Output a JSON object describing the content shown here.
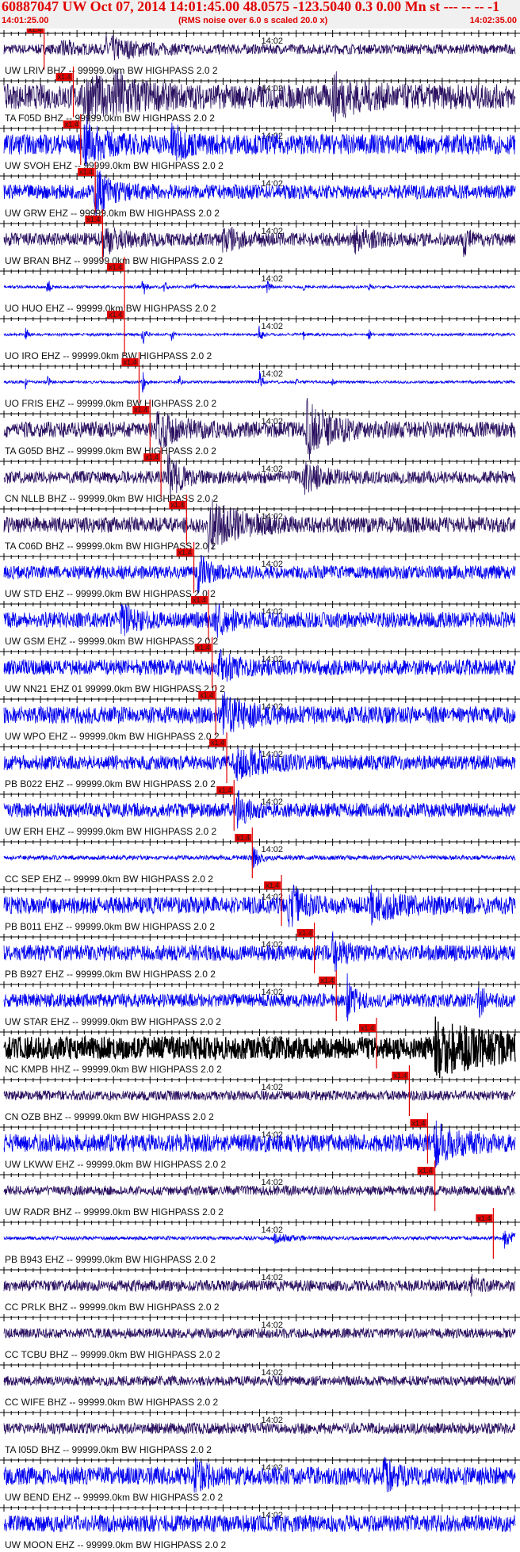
{
  "header": {
    "title": "60887047 UW Oct 07, 2014 14:01:45.00   48.0575 -123.5040  0.3 0.00 Mn st --- -- --   -1",
    "start_time": "14:01:25.00",
    "note": "(RMS noise over 6.0 s scaled 20.0 x)",
    "end_time": "14:02:35.00",
    "title_color": "#e00000"
  },
  "chart_data": {
    "type": "line",
    "title": "60887047 UW Oct 07, 2014 14:01:45.00   48.0575 -123.5040  0.3 0.00 Mn st --- -- --   -1",
    "x_range": [
      "14:01:25.00",
      "14:02:35.00"
    ],
    "x_range_seconds": [
      0,
      70
    ],
    "x_tick_label": "14:02",
    "x_tick_label_seconds": 35,
    "tick_interval_seconds": 1,
    "major_tick_interval_seconds": 5,
    "pick_label": "x1.4",
    "pick_color": "#e00000",
    "colors": {
      "eh": "#0000ee",
      "bh": "#2a1060",
      "hh": "#000000"
    },
    "traces": [
      {
        "label": "UW LRIV BHZ --  99999.0km BW  HIGHPASS  2.0  2",
        "kind": "bh",
        "pick_s": 5.5,
        "amp": 0.22,
        "bursts": [
          [
            14,
            2.2,
            4
          ],
          [
            8,
            1.6,
            1.5
          ]
        ]
      },
      {
        "label": "TA F05D BHZ --  99999.0km BW  HIGHPASS  2.0  2",
        "kind": "bh",
        "pick_s": 9.5,
        "amp": 0.55,
        "bursts": [
          [
            11,
            1.5,
            3
          ],
          [
            15,
            1.2,
            3
          ],
          [
            45,
            1.3,
            3
          ]
        ]
      },
      {
        "label": "UW SVOH EHZ --  99999.0km BW  HIGHPASS  2.0  2",
        "kind": "eh",
        "pick_s": 10.5,
        "amp": 0.45,
        "bursts": [
          [
            11,
            2.0,
            2
          ],
          [
            23,
            1.6,
            1.5
          ]
        ]
      },
      {
        "label": "UW GRW EHZ --  99999.0km BW  HIGHPASS  2.0  2",
        "kind": "eh",
        "pick_s": 12.5,
        "amp": 0.32,
        "bursts": [
          [
            12.5,
            3.0,
            2
          ]
        ]
      },
      {
        "label": "UW BRAN BHZ --  99999.0km BW  HIGHPASS  2.0  2",
        "kind": "bh",
        "pick_s": 13.5,
        "amp": 0.3,
        "bursts": [
          [
            13.5,
            2.0,
            2
          ],
          [
            30,
            1.7,
            2
          ],
          [
            48,
            1.4,
            2
          ],
          [
            63,
            2.2,
            0.6
          ]
        ]
      },
      {
        "label": "UO HUO EHZ --  99999.0km BW  HIGHPASS  2.0  2",
        "kind": "eh",
        "pick_s": 16.5,
        "amp": 0.06,
        "spiky": true,
        "bursts": [
          [
            6,
            8,
            0.25
          ],
          [
            19,
            10,
            0.3
          ],
          [
            22,
            5,
            0.2
          ],
          [
            26,
            4,
            0.2
          ],
          [
            36,
            6,
            0.3
          ],
          [
            41,
            4,
            0.2
          ],
          [
            50,
            3,
            0.2
          ]
        ]
      },
      {
        "label": "UO IRO EHZ --  99999.0km BW  HIGHPASS  2.0  2",
        "kind": "eh",
        "pick_s": 16.5,
        "amp": 0.06,
        "spiky": true,
        "bursts": [
          [
            3,
            5,
            0.2
          ],
          [
            19,
            8,
            0.3
          ],
          [
            23,
            5,
            0.2
          ],
          [
            35,
            8,
            0.3
          ],
          [
            41,
            3,
            0.2
          ],
          [
            50,
            4,
            0.2
          ]
        ]
      },
      {
        "label": "UO FRIS EHZ --  99999.0km BW  HIGHPASS  2.0  2",
        "kind": "eh",
        "pick_s": 18.5,
        "amp": 0.06,
        "spiky": true,
        "bursts": [
          [
            3,
            5,
            0.2
          ],
          [
            6,
            6,
            0.2
          ],
          [
            19,
            8,
            0.3
          ],
          [
            24,
            5,
            0.2
          ],
          [
            35,
            8,
            0.3
          ],
          [
            40,
            3,
            0.2
          ],
          [
            45,
            2,
            0.2
          ]
        ]
      },
      {
        "label": "TA G05D BHZ --  99999.0km BW  HIGHPASS  2.0  2",
        "kind": "bh",
        "pick_s": 20.0,
        "amp": 0.35,
        "bursts": [
          [
            21,
            1.8,
            3
          ],
          [
            41.5,
            3.2,
            3
          ]
        ]
      },
      {
        "label": "CN NLLB BHZ --  99999.0km BW  HIGHPASS  2.0  2",
        "kind": "bh",
        "pick_s": 21.5,
        "amp": 0.28,
        "bursts": [
          [
            22.5,
            3.5,
            1.5
          ],
          [
            41,
            2.0,
            2.5
          ]
        ]
      },
      {
        "label": "TA C06D BHZ --  99999.0km BW  HIGHPASS  2.0  2",
        "kind": "bh",
        "pick_s": 25.0,
        "amp": 0.35,
        "bursts": [
          [
            28,
            2.6,
            4
          ]
        ]
      },
      {
        "label": "UW STD EHZ --  99999.0km BW  HIGHPASS  2.0  2",
        "kind": "eh",
        "pick_s": 26.0,
        "amp": 0.3,
        "bursts": [
          [
            26.5,
            3.0,
            1.2
          ]
        ]
      },
      {
        "label": "UW GSM EHZ --  99999.0km BW  HIGHPASS  2.0  2",
        "kind": "eh",
        "pick_s": 28.0,
        "amp": 0.35,
        "bursts": [
          [
            16,
            1.5,
            2
          ],
          [
            29,
            1.6,
            2
          ]
        ]
      },
      {
        "label": "UW NN21 EHZ 01  99999.0km BW  HIGHPASS  2.0  2",
        "kind": "eh",
        "pick_s": 28.5,
        "amp": 0.35,
        "bursts": [
          [
            29.5,
            1.5,
            2
          ]
        ]
      },
      {
        "label": "UW WPO EHZ --  99999.0km BW  HIGHPASS  2.0  2",
        "kind": "eh",
        "pick_s": 29.0,
        "amp": 0.38,
        "bursts": [
          [
            30,
            2.0,
            3
          ]
        ]
      },
      {
        "label": "PB B022 EHZ --  99999.0km BW  HIGHPASS  2.0  2",
        "kind": "eh",
        "pick_s": 30.5,
        "amp": 0.32,
        "bursts": [
          [
            31.5,
            1.8,
            4
          ]
        ]
      },
      {
        "label": "UW ERH EHZ --  99999.0km BW  HIGHPASS  2.0  2",
        "kind": "eh",
        "pick_s": 31.5,
        "amp": 0.32,
        "bursts": [
          [
            32,
            2.4,
            1
          ]
        ]
      },
      {
        "label": "CC SEP EHZ --  99999.0km BW  HIGHPASS  2.0  2",
        "kind": "eh",
        "pick_s": 34.0,
        "amp": 0.1,
        "bursts": [
          [
            34,
            6,
            0.8
          ]
        ]
      },
      {
        "label": "PB B011 EHZ --  99999.0km BW  HIGHPASS  2.0  2",
        "kind": "eh",
        "pick_s": 38.0,
        "amp": 0.38,
        "bursts": [
          [
            39,
            2.2,
            1.5
          ],
          [
            50,
            1.5,
            4
          ]
        ]
      },
      {
        "label": "PB B927 EHZ --  99999.0km BW  HIGHPASS  2.0  2",
        "kind": "eh",
        "pick_s": 42.5,
        "amp": 0.35,
        "bursts": [
          [
            45,
            1.8,
            1.5
          ]
        ]
      },
      {
        "label": "UW STAR EHZ --  99999.0km BW  HIGHPASS  2.0  2",
        "kind": "eh",
        "pick_s": 45.5,
        "amp": 0.3,
        "bursts": [
          [
            47,
            3.5,
            0.8
          ],
          [
            65,
            2.2,
            0.8
          ]
        ]
      },
      {
        "label": "NC KMPB HHZ --  99999.0km BW  HIGHPASS  2.0  2",
        "kind": "hh",
        "pick_s": 51.0,
        "amp": 0.5,
        "bursts": [
          [
            59,
            1.9,
            7
          ]
        ]
      },
      {
        "label": "CN OZB BHZ --  99999.0km BW  HIGHPASS  2.0  2",
        "kind": "bh",
        "pick_s": 55.5,
        "amp": 0.22,
        "bursts": []
      },
      {
        "label": "UW LKWW EHZ --  99999.0km BW  HIGHPASS  2.0  2",
        "kind": "eh",
        "pick_s": 58.0,
        "amp": 0.4,
        "bursts": [
          [
            59,
            1.8,
            3
          ]
        ]
      },
      {
        "label": "UW RADR BHZ --  99999.0km BW  HIGHPASS  2.0  2",
        "kind": "bh",
        "pick_s": 59.0,
        "amp": 0.22,
        "bursts": []
      },
      {
        "label": "PB B943 EHZ --  99999.0km BW  HIGHPASS  2.0  2",
        "kind": "eh",
        "pick_s": 67.0,
        "amp": 0.08,
        "bursts": [
          [
            37,
            2.5,
            2
          ],
          [
            68.5,
            5,
            1.5
          ]
        ]
      },
      {
        "label": "CC PRLK BHZ --  99999.0km BW  HIGHPASS  2.0  2",
        "kind": "bh",
        "amp": 0.25,
        "bursts": [
          [
            64,
            1.5,
            1
          ]
        ]
      },
      {
        "label": "CC TCBU BHZ --  99999.0km BW  HIGHPASS  2.0  2",
        "kind": "bh",
        "amp": 0.22,
        "bursts": []
      },
      {
        "label": "CC WIFE BHZ --  99999.0km BW  HIGHPASS  2.0  2",
        "kind": "bh",
        "amp": 0.22,
        "bursts": []
      },
      {
        "label": "TA I05D BHZ --  99999.0km BW  HIGHPASS  2.0  2",
        "kind": "bh",
        "amp": 0.25,
        "bursts": []
      },
      {
        "label": "UW BEND EHZ --  99999.0km BW  HIGHPASS  2.0  2",
        "kind": "eh",
        "amp": 0.4,
        "bursts": [
          [
            26,
            1.3,
            2
          ],
          [
            52,
            1.3,
            2
          ]
        ]
      },
      {
        "label": "UW MOON EHZ --  99999.0km BW  HIGHPASS  2.0  2",
        "kind": "eh",
        "amp": 0.38,
        "bursts": []
      }
    ]
  }
}
